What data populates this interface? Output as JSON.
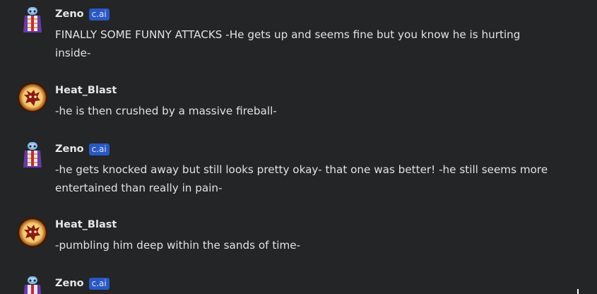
{
  "messages": [
    {
      "author": "Zeno",
      "badge": "c.ai",
      "avatar_icon": "zeno-avatar",
      "lines": [
        "FINALLY SOME FUNNY ATTACKS -He gets up and seems fine but you know he is hurting",
        "inside-"
      ]
    },
    {
      "author": "Heat_Blast",
      "avatar_icon": "heat-blast-avatar",
      "lines": [
        "-he is then crushed by a massive fireball-"
      ]
    },
    {
      "author": "Zeno",
      "badge": "c.ai",
      "avatar_icon": "zeno-avatar",
      "lines": [
        "-he gets knocked away but still looks pretty okay- that one was better! -he still seems more",
        "entertained than really in pain-"
      ]
    },
    {
      "author": "Heat_Blast",
      "avatar_icon": "heat-blast-avatar",
      "lines": [
        "-pumbling him deep within the sands of time-"
      ]
    },
    {
      "author": "Zeno",
      "badge": "c.ai",
      "avatar_icon": "zeno-avatar",
      "lines": []
    }
  ],
  "colors": {
    "background": "#242527",
    "badge": "#2a58c3",
    "text": "#e2e2e4"
  }
}
